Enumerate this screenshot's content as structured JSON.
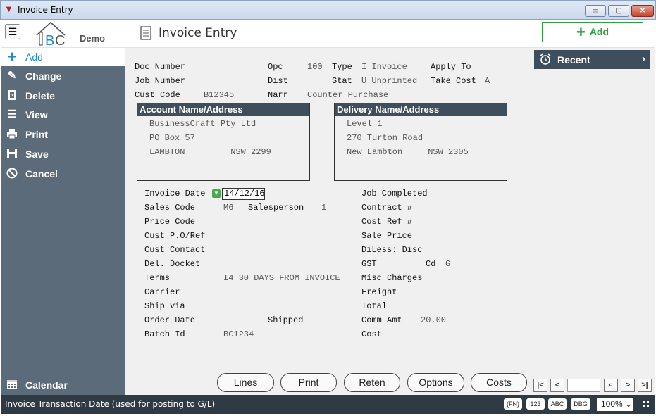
{
  "window": {
    "title": "Invoice Entry",
    "min_glyph": "▭",
    "max_glyph": "▢",
    "close_glyph": "✕"
  },
  "header": {
    "logo_text": "Demo",
    "page_title": "Invoice Entry",
    "add_label": "Add"
  },
  "sidebar": {
    "items": [
      {
        "label": "Add",
        "icon": "plus-icon",
        "glyph": "+"
      },
      {
        "label": "Change",
        "icon": "pencil-icon",
        "glyph": "✎"
      },
      {
        "label": "Delete",
        "icon": "trash-icon",
        "glyph": "🗑"
      },
      {
        "label": "View",
        "icon": "list-icon",
        "glyph": "☰"
      },
      {
        "label": "Print",
        "icon": "printer-icon",
        "glyph": "⎙"
      },
      {
        "label": "Save",
        "icon": "floppy-icon",
        "glyph": "💾"
      },
      {
        "label": "Cancel",
        "icon": "cancel-icon",
        "glyph": "⃠"
      }
    ],
    "calendar_label": "Calendar"
  },
  "recent": {
    "label": "Recent"
  },
  "header_fields": {
    "doc_number_label": "Doc Number",
    "job_number_label": "Job Number",
    "cust_code_label": "Cust Code",
    "cust_code_value": "B12345",
    "opc_label": "Opc",
    "opc_value": "100",
    "dist_label": "Dist",
    "narr_label": "Narr",
    "narr_value": "Counter Purchase",
    "type_label": "Type",
    "type_value": "I Invoice",
    "stat_label": "Stat",
    "stat_value": "U Unprinted",
    "apply_to_label": "Apply To",
    "take_cost_label": "Take Cost",
    "take_cost_value": "A"
  },
  "account_address": {
    "title": "Account Name/Address",
    "line1": "BusinessCraft Pty Ltd",
    "line2": "PO Box 57",
    "line3": "LAMBTON         NSW 2299"
  },
  "delivery_address": {
    "title": "Delivery Name/Address",
    "line1": "Level 1",
    "line2": "270 Turton Road",
    "line3": "New Lambton     NSW 2305"
  },
  "left_fields": {
    "invoice_date_label": "Invoice Date",
    "invoice_date_value": "14/12/16",
    "sales_code_label": "Sales Code",
    "sales_code_value": "M6",
    "salesperson_label": "Salesperson",
    "salesperson_value": "1",
    "price_code_label": "Price Code",
    "cust_po_label": "Cust P.O/Ref",
    "cust_contact_label": "Cust Contact",
    "del_docket_label": "Del. Docket",
    "terms_label": "Terms",
    "terms_value": "I4 30 DAYS FROM INVOICE",
    "carrier_label": "Carrier",
    "ship_via_label": "Ship via",
    "order_date_label": "Order Date",
    "shipped_label": "Shipped",
    "batch_id_label": "Batch Id",
    "batch_id_value": "BC1234"
  },
  "right_fields": {
    "job_completed_label": "Job Completed",
    "contract_label": "Contract #",
    "cost_ref_label": "Cost Ref #",
    "sale_price_label": "Sale Price",
    "diless_label": "DiLess: Disc",
    "gst_label": "GST",
    "cd_label": "Cd",
    "cd_value": "G",
    "misc_charges_label": "Misc Charges",
    "freight_label": "Freight",
    "total_label": "Total",
    "comm_amt_label": "Comm Amt",
    "comm_amt_value": "20.00",
    "cost_label": "Cost"
  },
  "actions": {
    "lines": "Lines",
    "print": "Print",
    "reten": "Reten",
    "options": "Options",
    "costs": "Costs"
  },
  "nav": {
    "first": "|<",
    "prev": "<",
    "search": "⌕",
    "next": ">",
    "last": ">|"
  },
  "status": {
    "message": "Invoice Transaction Date (used for posting to G/L)",
    "fn": "(FN)",
    "num": "123",
    "abc": "ABC",
    "dbg": "DBG",
    "zoom": "100%"
  },
  "colors": {
    "sidebar": "#5b6b7a",
    "accent_blue": "#1e8ad6",
    "add_green": "#2e9f3d",
    "dark_header": "#3f4e5c",
    "statusbar": "#2f3a44"
  }
}
